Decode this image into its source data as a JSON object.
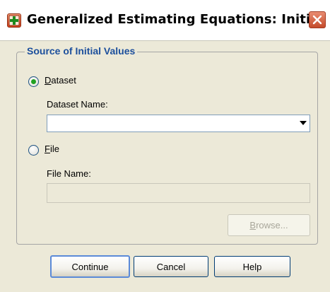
{
  "window": {
    "title": "Generalized Estimating Equations: Initi...",
    "close_icon": "close-icon",
    "app_icon": "spss-dialog-icon"
  },
  "group": {
    "label": "Source of Initial Values"
  },
  "dataset_option": {
    "label": "Dataset",
    "selected": true,
    "field_label": "Dataset Name:",
    "value": ""
  },
  "file_option": {
    "label": "File",
    "selected": false,
    "field_label": "File Name:",
    "value": ""
  },
  "buttons": {
    "browse": "Browse...",
    "continue": "Continue",
    "cancel": "Cancel",
    "help": "Help"
  },
  "colors": {
    "group_label": "#1c4f9c",
    "radio_selected": "#21a121",
    "dialog_bg": "#ece9d8"
  }
}
